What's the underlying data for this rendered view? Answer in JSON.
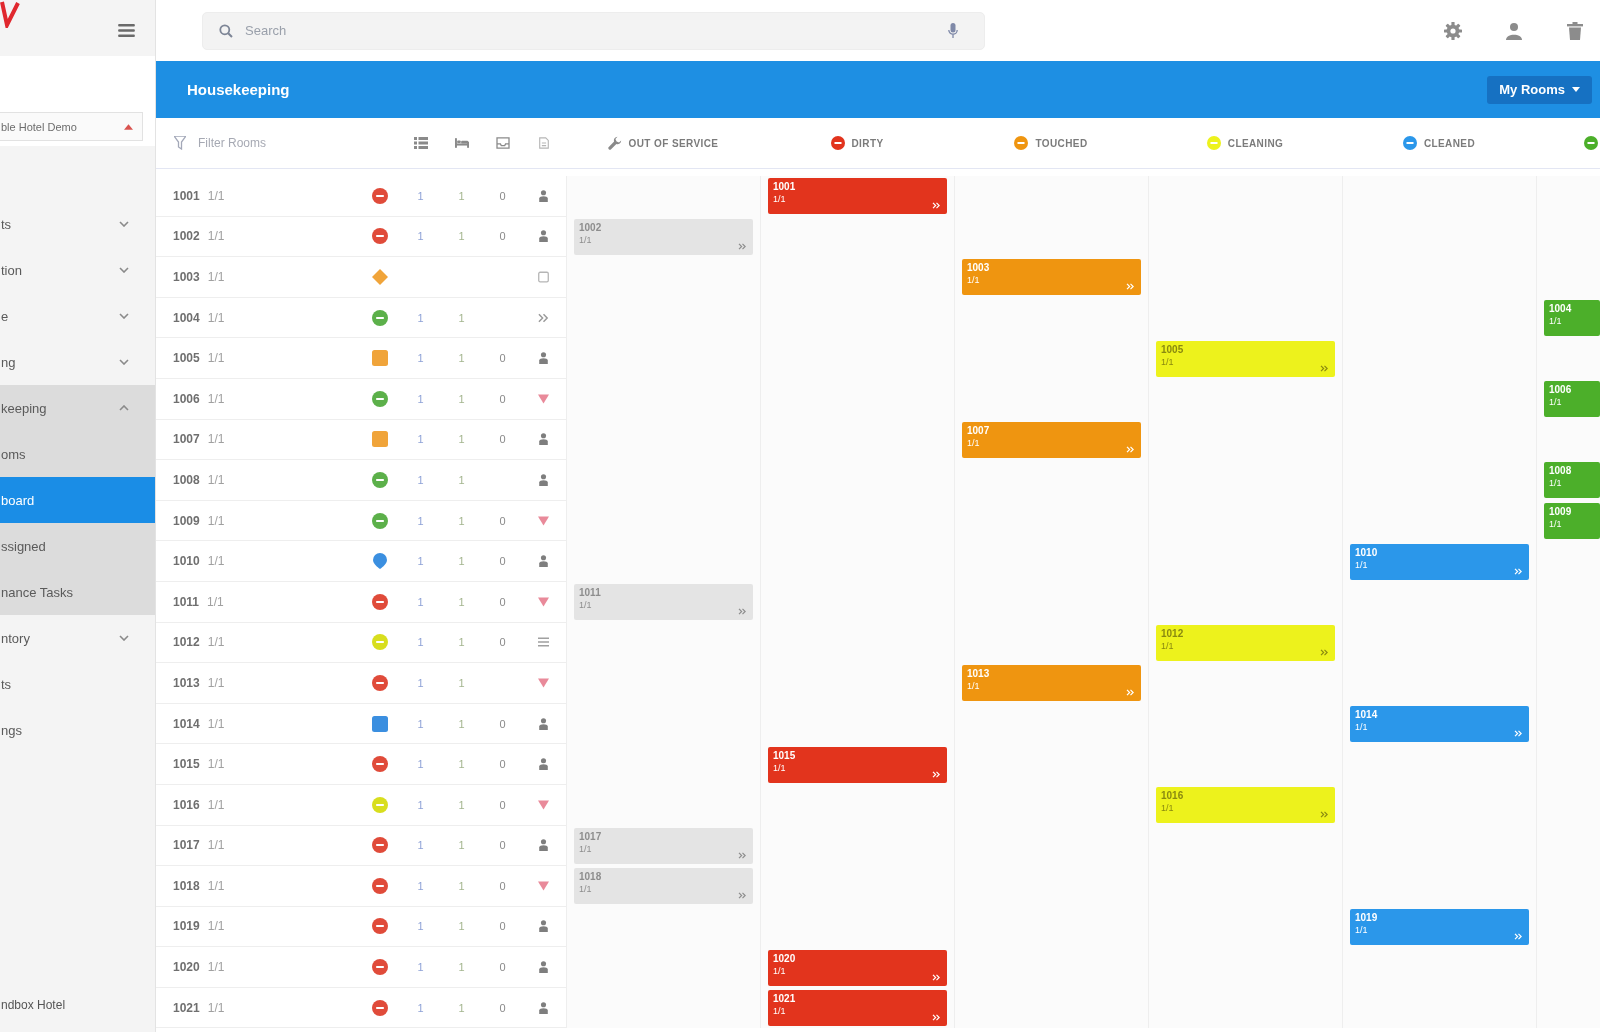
{
  "sidebar": {
    "property_select": {
      "value": "ble Hotel Demo"
    },
    "items": [
      {
        "label": "ts",
        "kind": "group",
        "expanded": false,
        "selected": false
      },
      {
        "label": "tion",
        "kind": "group",
        "expanded": false,
        "selected": false
      },
      {
        "label": "e",
        "kind": "group",
        "expanded": false,
        "selected": false
      },
      {
        "label": "ng",
        "kind": "group",
        "expanded": false,
        "selected": false
      },
      {
        "label": "keeping",
        "kind": "group",
        "expanded": true,
        "selected": false,
        "children": [
          {
            "label": "oms",
            "selected": false
          },
          {
            "label": "board",
            "selected": true
          },
          {
            "label": "ssigned",
            "selected": false
          },
          {
            "label": "nance Tasks",
            "selected": false
          }
        ]
      },
      {
        "label": "ntory",
        "kind": "group",
        "expanded": false,
        "selected": false
      },
      {
        "label": "ts",
        "kind": "link",
        "selected": false
      },
      {
        "label": "ngs",
        "kind": "link",
        "selected": false
      }
    ],
    "footer": "ndbox Hotel"
  },
  "search": {
    "placeholder": "Search"
  },
  "header": {
    "title": "Housekeeping",
    "view_button": "My Rooms"
  },
  "filter": {
    "placeholder": "Filter Rooms"
  },
  "board": {
    "columns": [
      {
        "kind": "out_of_service",
        "label": "OUT OF SERVICE",
        "color": "#e4e4e4"
      },
      {
        "kind": "dirty",
        "label": "DIRTY",
        "color": "#e2341d"
      },
      {
        "kind": "touched",
        "label": "TOUCHED",
        "color": "#ef9510"
      },
      {
        "kind": "cleaning",
        "label": "CLEANING",
        "color": "#edf21c"
      },
      {
        "kind": "cleaned",
        "label": "CLEANED",
        "color": "#2b97ea"
      },
      {
        "kind": "column_6",
        "color": "#4caf2a"
      }
    ],
    "rows": [
      {
        "room": "1001",
        "room_type": "1/1",
        "status_icon": {
          "kind": "circle",
          "color": "#e04b3a"
        },
        "counts": [
          "1",
          "1",
          "0"
        ],
        "flag_icon": {
          "kind": "person"
        },
        "card": {
          "kind": "dirty",
          "title": "1001",
          "subtitle": "1/1"
        }
      },
      {
        "room": "1002",
        "room_type": "1/1",
        "status_icon": {
          "kind": "circle",
          "color": "#e04b3a"
        },
        "counts": [
          "1",
          "1",
          "0"
        ],
        "flag_icon": {
          "kind": "person"
        },
        "card": {
          "kind": "out_of_service",
          "title": "1002",
          "subtitle": "1/1"
        }
      },
      {
        "room": "1003",
        "room_type": "1/1",
        "status_icon": {
          "kind": "diamond",
          "color": "#f0a43a"
        },
        "flag_icon": {
          "kind": "box"
        },
        "card": {
          "kind": "touched",
          "title": "1003",
          "subtitle": "1/1"
        }
      },
      {
        "room": "1004",
        "room_type": "1/1",
        "status_icon": {
          "kind": "circle",
          "color": "#5cb04a"
        },
        "counts": [
          "1",
          "1"
        ],
        "flag_icon": {
          "kind": "chevrons"
        },
        "card": {
          "kind": "column_6",
          "title": "1004",
          "subtitle": "1/1"
        }
      },
      {
        "room": "1005",
        "room_type": "1/1",
        "status_icon": {
          "kind": "square",
          "color": "#f0a43a"
        },
        "counts": [
          "1",
          "1",
          "0"
        ],
        "flag_icon": {
          "kind": "person"
        },
        "card": {
          "kind": "cleaning",
          "title": "1005",
          "subtitle": "1/1"
        }
      },
      {
        "room": "1006",
        "room_type": "1/1",
        "status_icon": {
          "kind": "circle",
          "color": "#5cb04a"
        },
        "counts": [
          "1",
          "1",
          "0"
        ],
        "flag_icon": {
          "kind": "triangle"
        },
        "card": {
          "kind": "column_6",
          "title": "1006",
          "subtitle": "1/1"
        }
      },
      {
        "room": "1007",
        "room_type": "1/1",
        "status_icon": {
          "kind": "square",
          "color": "#f0a43a"
        },
        "counts": [
          "1",
          "1",
          "0"
        ],
        "flag_icon": {
          "kind": "person"
        },
        "card": {
          "kind": "touched",
          "title": "1007",
          "subtitle": "1/1"
        }
      },
      {
        "room": "1008",
        "room_type": "1/1",
        "status_icon": {
          "kind": "circle",
          "color": "#5cb04a"
        },
        "counts": [
          "1",
          "1"
        ],
        "flag_icon": {
          "kind": "person"
        },
        "card": {
          "kind": "column_6",
          "title": "1008",
          "subtitle": "1/1"
        }
      },
      {
        "room": "1009",
        "room_type": "1/1",
        "status_icon": {
          "kind": "circle",
          "color": "#5cb04a"
        },
        "counts": [
          "1",
          "1",
          "0"
        ],
        "flag_icon": {
          "kind": "triangle"
        },
        "card": {
          "kind": "column_6",
          "title": "1009",
          "subtitle": "1/1"
        }
      },
      {
        "room": "1010",
        "room_type": "1/1",
        "status_icon": {
          "kind": "pin",
          "color": "#3b8fe0"
        },
        "counts": [
          "1",
          "1",
          "0"
        ],
        "flag_icon": {
          "kind": "person"
        },
        "card": {
          "kind": "cleaned",
          "title": "1010",
          "subtitle": "1/1"
        }
      },
      {
        "room": "1011",
        "room_type": "1/1",
        "status_icon": {
          "kind": "circle",
          "color": "#e04b3a"
        },
        "counts": [
          "1",
          "1",
          "0"
        ],
        "flag_icon": {
          "kind": "triangle"
        },
        "card": {
          "kind": "out_of_service",
          "title": "1011",
          "subtitle": "1/1"
        }
      },
      {
        "room": "1012",
        "room_type": "1/1",
        "status_icon": {
          "kind": "circle",
          "color": "#d8de1e"
        },
        "counts": [
          "1",
          "1",
          "0"
        ],
        "flag_icon": {
          "kind": "lines"
        },
        "card": {
          "kind": "cleaning",
          "title": "1012",
          "subtitle": "1/1"
        }
      },
      {
        "room": "1013",
        "room_type": "1/1",
        "status_icon": {
          "kind": "circle",
          "color": "#e04b3a"
        },
        "counts": [
          "1",
          "1"
        ],
        "flag_icon": {
          "kind": "triangle"
        },
        "card": {
          "kind": "touched",
          "title": "1013",
          "subtitle": "1/1"
        }
      },
      {
        "room": "1014",
        "room_type": "1/1",
        "status_icon": {
          "kind": "square",
          "color": "#3b8fe0"
        },
        "counts": [
          "1",
          "1",
          "0"
        ],
        "flag_icon": {
          "kind": "person"
        },
        "card": {
          "kind": "cleaned",
          "title": "1014",
          "subtitle": "1/1"
        }
      },
      {
        "room": "1015",
        "room_type": "1/1",
        "status_icon": {
          "kind": "circle",
          "color": "#e04b3a"
        },
        "counts": [
          "1",
          "1",
          "0"
        ],
        "flag_icon": {
          "kind": "person"
        },
        "card": {
          "kind": "dirty",
          "title": "1015",
          "subtitle": "1/1"
        }
      },
      {
        "room": "1016",
        "room_type": "1/1",
        "status_icon": {
          "kind": "circle",
          "color": "#d8de1e"
        },
        "counts": [
          "1",
          "1",
          "0"
        ],
        "flag_icon": {
          "kind": "triangle"
        },
        "card": {
          "kind": "cleaning",
          "title": "1016",
          "subtitle": "1/1"
        }
      },
      {
        "room": "1017",
        "room_type": "1/1",
        "status_icon": {
          "kind": "circle",
          "color": "#e04b3a"
        },
        "counts": [
          "1",
          "1",
          "0"
        ],
        "flag_icon": {
          "kind": "person"
        },
        "card": {
          "kind": "out_of_service",
          "title": "1017",
          "subtitle": "1/1"
        }
      },
      {
        "room": "1018",
        "room_type": "1/1",
        "status_icon": {
          "kind": "circle",
          "color": "#e04b3a"
        },
        "counts": [
          "1",
          "1",
          "0"
        ],
        "flag_icon": {
          "kind": "triangle"
        },
        "card": {
          "kind": "out_of_service",
          "title": "1018",
          "subtitle": "1/1"
        }
      },
      {
        "room": "1019",
        "room_type": "1/1",
        "status_icon": {
          "kind": "circle",
          "color": "#e04b3a"
        },
        "counts": [
          "1",
          "1",
          "0"
        ],
        "flag_icon": {
          "kind": "person"
        },
        "card": {
          "kind": "cleaned",
          "title": "1019",
          "subtitle": "1/1"
        }
      },
      {
        "room": "1020",
        "room_type": "1/1",
        "status_icon": {
          "kind": "circle",
          "color": "#e04b3a"
        },
        "counts": [
          "1",
          "1",
          "0"
        ],
        "flag_icon": {
          "kind": "person"
        },
        "card": {
          "kind": "dirty",
          "title": "1020",
          "subtitle": "1/1"
        }
      },
      {
        "room": "1021",
        "room_type": "1/1",
        "status_icon": {
          "kind": "circle",
          "color": "#e04b3a"
        },
        "counts": [
          "1",
          "1",
          "0"
        ],
        "flag_icon": {
          "kind": "person"
        },
        "card": {
          "kind": "dirty",
          "title": "1021",
          "subtitle": "1/1"
        }
      }
    ]
  }
}
